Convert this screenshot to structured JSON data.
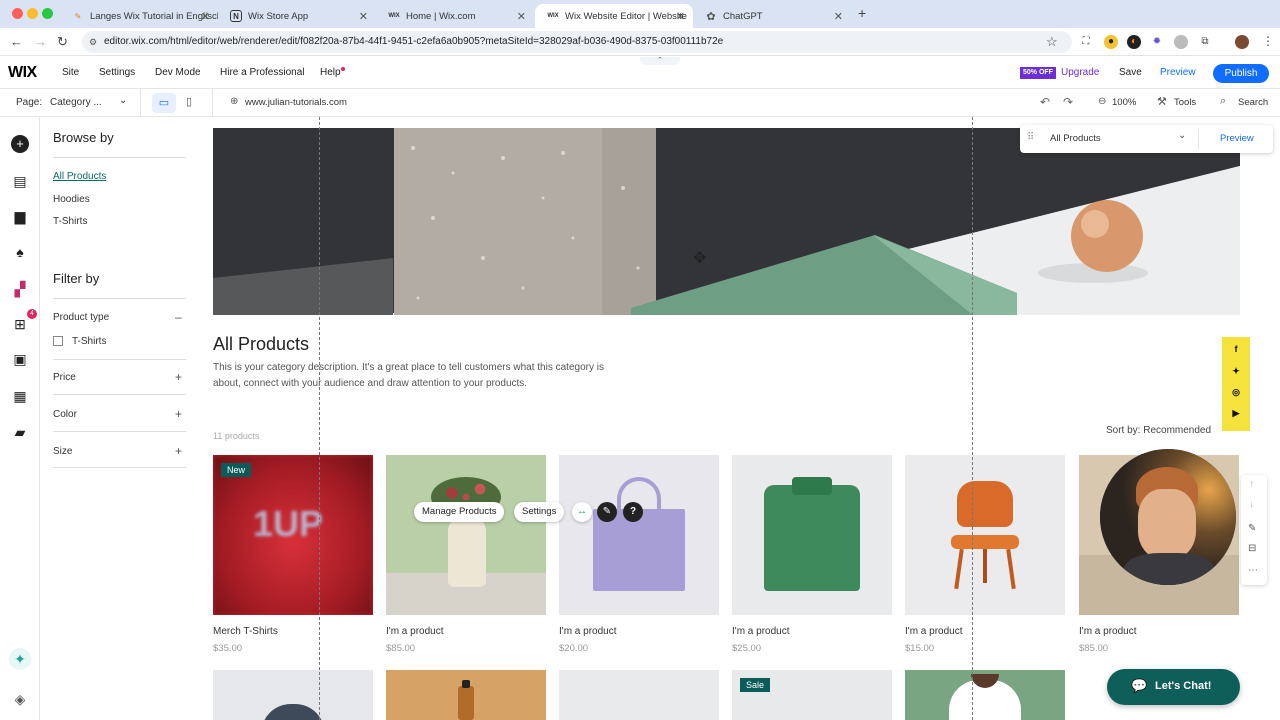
{
  "browser": {
    "tabs": [
      {
        "title": "Langes Wix Tutorial in Englisch",
        "icon": "pen-icon"
      },
      {
        "title": "Wix Store App",
        "icon": "notion-icon"
      },
      {
        "title": "Home | Wix.com",
        "icon": "wix-icon"
      },
      {
        "title": "Wix Website Editor | Website",
        "icon": "wix-icon"
      },
      {
        "title": "ChatGPT",
        "icon": "chatgpt-icon"
      }
    ],
    "new_tab": "+",
    "url": "editor.wix.com/html/editor/web/renderer/edit/f082f20a-87b4-44f1-9451-c2efa6a0b905?metaSiteId=328029af-b036-490d-8375-03f00111b72e"
  },
  "editor": {
    "logo": "WIX",
    "menu": [
      "Site",
      "Settings",
      "Dev Mode",
      "Hire a Professional",
      "Help"
    ],
    "badge": "50% OFF",
    "upgrade": "Upgrade",
    "save": "Save",
    "preview": "Preview",
    "publish": "Publish",
    "page_label": "Page:",
    "page_value": "Category ...",
    "domain": "www.julian-tutorials.com",
    "zoom": "100%",
    "tools": "Tools",
    "search": "Search",
    "rail_badge": "4"
  },
  "sidebar": {
    "browse_heading": "Browse by",
    "browse_items": [
      "All Products",
      "Hoodies",
      "T-Shirts"
    ],
    "filter_heading": "Filter by",
    "product_type": "Product type",
    "product_type_option": "T-Shirts",
    "filters": [
      "Price",
      "Color",
      "Size"
    ]
  },
  "category": {
    "title": "All Products",
    "description_line1": "This is your category description. It's a great place to tell customers what this category is",
    "description_line2": "about, connect with your audience and draw attention to your products.",
    "count": "11 products",
    "sort": "Sort by: Recommended"
  },
  "products": [
    {
      "name": "Merch T-Shirts",
      "price": "$35.00",
      "badge": "New",
      "bg": "#c0222a"
    },
    {
      "name": "I'm a product",
      "price": "$85.00",
      "badge": "",
      "bg": "#b9cfa8"
    },
    {
      "name": "I'm a product",
      "price": "$20.00",
      "badge": "",
      "bg": "#e8e8ec"
    },
    {
      "name": "I'm a product",
      "price": "$25.00",
      "badge": "",
      "bg": "#e9eaec"
    },
    {
      "name": "I'm a product",
      "price": "$15.00",
      "badge": "",
      "bg": "#ebebed"
    },
    {
      "name": "I'm a product",
      "price": "$85.00",
      "badge": "",
      "bg": "#d9c8b0"
    }
  ],
  "row2_badge": "Sale",
  "floating": {
    "manage_products": "Manage Products",
    "settings": "Settings",
    "dropdown": "All Products",
    "preview": "Preview"
  },
  "chat": {
    "label": "Let's Chat!"
  },
  "colors": {
    "wix_blue": "#116dff",
    "badge_purple": "#6b2fd6",
    "badge_teal": "#0b5b59",
    "social_yellow": "#f5e33c",
    "chat_teal": "#0e5f5a"
  }
}
